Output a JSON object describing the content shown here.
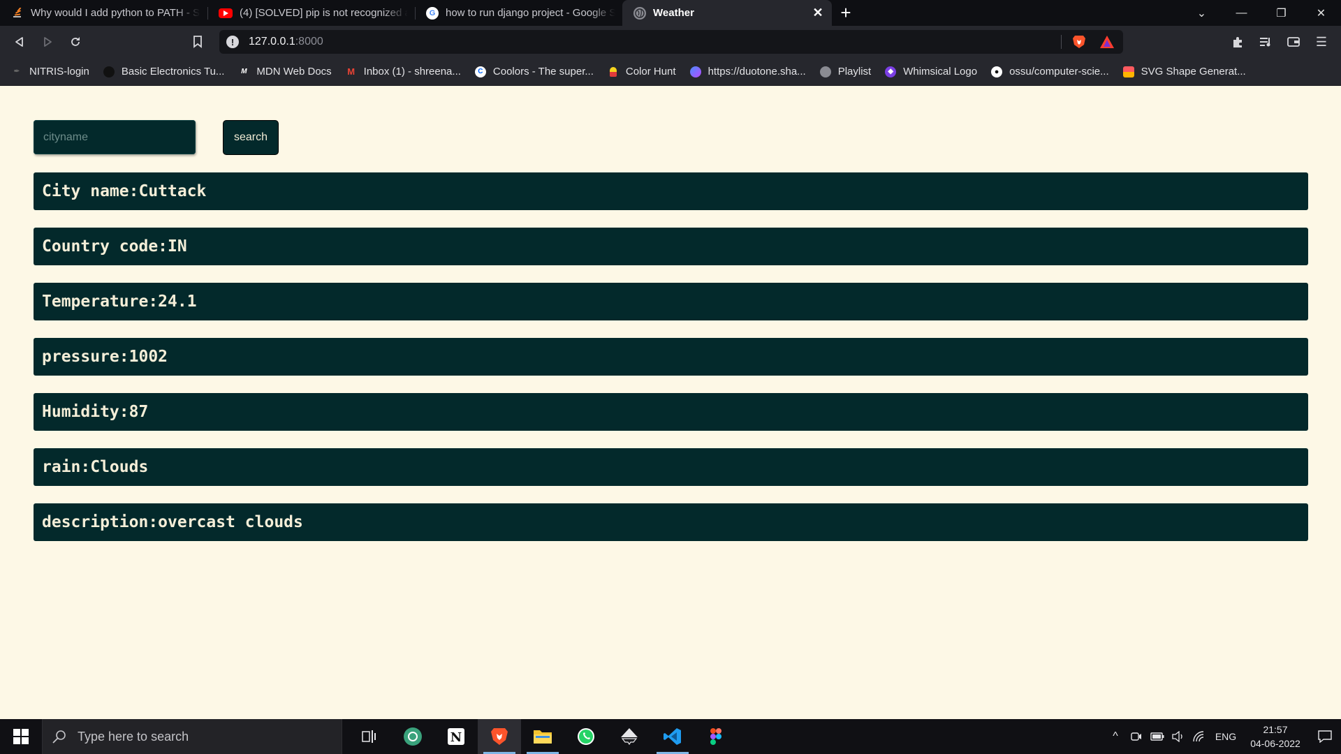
{
  "browser": {
    "tabs": [
      {
        "title": "Why would I add python to PATH - Sta",
        "icon": "stackoverflow-icon"
      },
      {
        "title": "(4) [SOLVED] pip is not recognized as a",
        "icon": "youtube-icon"
      },
      {
        "title": "how to run django project - Google Se",
        "icon": "google-icon"
      },
      {
        "title": "Weather",
        "icon": "globe-icon",
        "active": true
      }
    ],
    "url": {
      "host": "127.0.0.1",
      "port": ":8000"
    },
    "bookmarks": [
      "NITRIS-login",
      "Basic Electronics Tu...",
      "MDN Web Docs",
      "Inbox (1) - shreena...",
      "Coolors - The super...",
      "Color Hunt",
      "https://duotone.sha...",
      "Playlist",
      "Whimsical Logo",
      "ossu/computer-scie...",
      "SVG Shape Generat..."
    ]
  },
  "form": {
    "placeholder": "cityname",
    "search_label": "search"
  },
  "results": [
    "City name:Cuttack",
    "Country code:IN",
    "Temperature:24.1",
    "pressure:1002",
    "Humidity:87",
    "rain:Clouds",
    "description:overcast clouds"
  ],
  "taskbar": {
    "search_placeholder": "Type here to search",
    "language": "ENG",
    "time": "21:57",
    "date": "04-06-2022"
  },
  "colors": {
    "page_bg": "#fdf8e6",
    "panel_bg": "#03292b",
    "panel_text": "#f4eed8"
  }
}
